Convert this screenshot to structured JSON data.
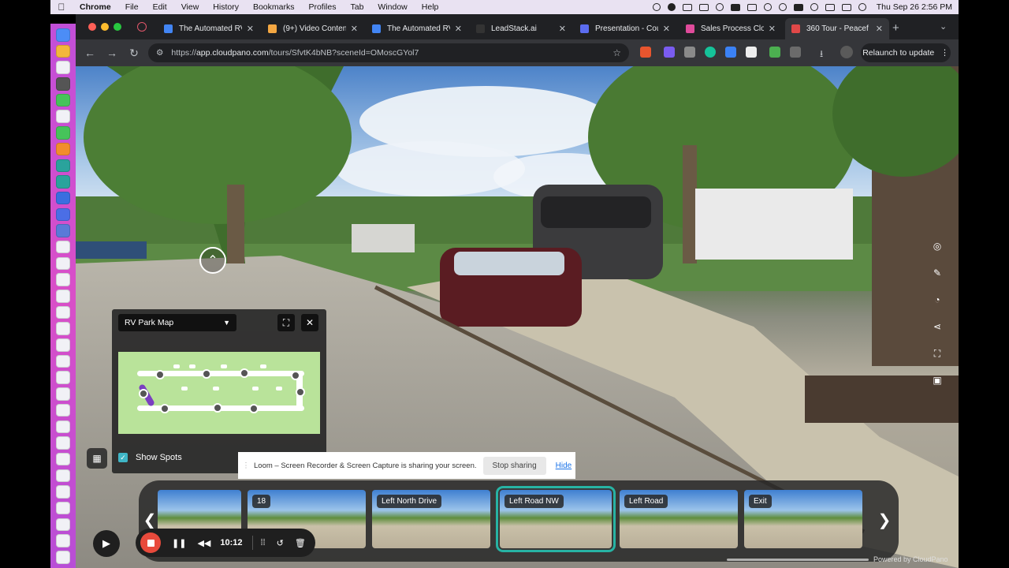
{
  "menubar": {
    "app": "Chrome",
    "items": [
      "File",
      "Edit",
      "View",
      "History",
      "Bookmarks",
      "Profiles",
      "Tab",
      "Window",
      "Help"
    ],
    "clock": "Thu Sep 26  2:56 PM"
  },
  "browser": {
    "tabs": [
      {
        "title": "The Automated RV",
        "active": false,
        "favicon_color": "#4285f4"
      },
      {
        "title": "(9+) Video Conten",
        "active": false,
        "favicon_color": "#f4a742"
      },
      {
        "title": "The Automated RV",
        "active": false,
        "favicon_color": "#4285f4"
      },
      {
        "title": "LeadStack.ai",
        "active": false,
        "favicon_color": "#333333"
      },
      {
        "title": "Presentation - Cou",
        "active": false,
        "favicon_color": "#5b6cf0"
      },
      {
        "title": "Sales Process Clou",
        "active": false,
        "favicon_color": "#e04b9b"
      },
      {
        "title": "360 Tour - Peacef",
        "active": true,
        "favicon_color": "#e04848"
      }
    ],
    "url_prefix": "https://",
    "url_domain": "app.cloudpano.com",
    "url_path": "/tours/SfvtK4bNB?sceneId=OMoscGYol7",
    "relaunch_label": "Relaunch to update"
  },
  "tour": {
    "map": {
      "selected": "RV Park Map",
      "show_spots_label": "Show Spots",
      "show_spots_checked": true
    },
    "scene_strip": {
      "scenes": [
        {
          "label": "",
          "active": false
        },
        {
          "label": "18",
          "active": false
        },
        {
          "label": "Left North Drive",
          "active": false
        },
        {
          "label": "Left Road NW",
          "active": true
        },
        {
          "label": "Left Road",
          "active": false
        },
        {
          "label": "Exit",
          "active": false
        }
      ]
    },
    "powered_by": "Powered by CloudPano"
  },
  "loom": {
    "message": "Loom – Screen Recorder & Screen Capture is sharing your screen.",
    "stop_label": "Stop sharing",
    "hide_label": "Hide"
  },
  "recorder": {
    "time": "10:12"
  }
}
